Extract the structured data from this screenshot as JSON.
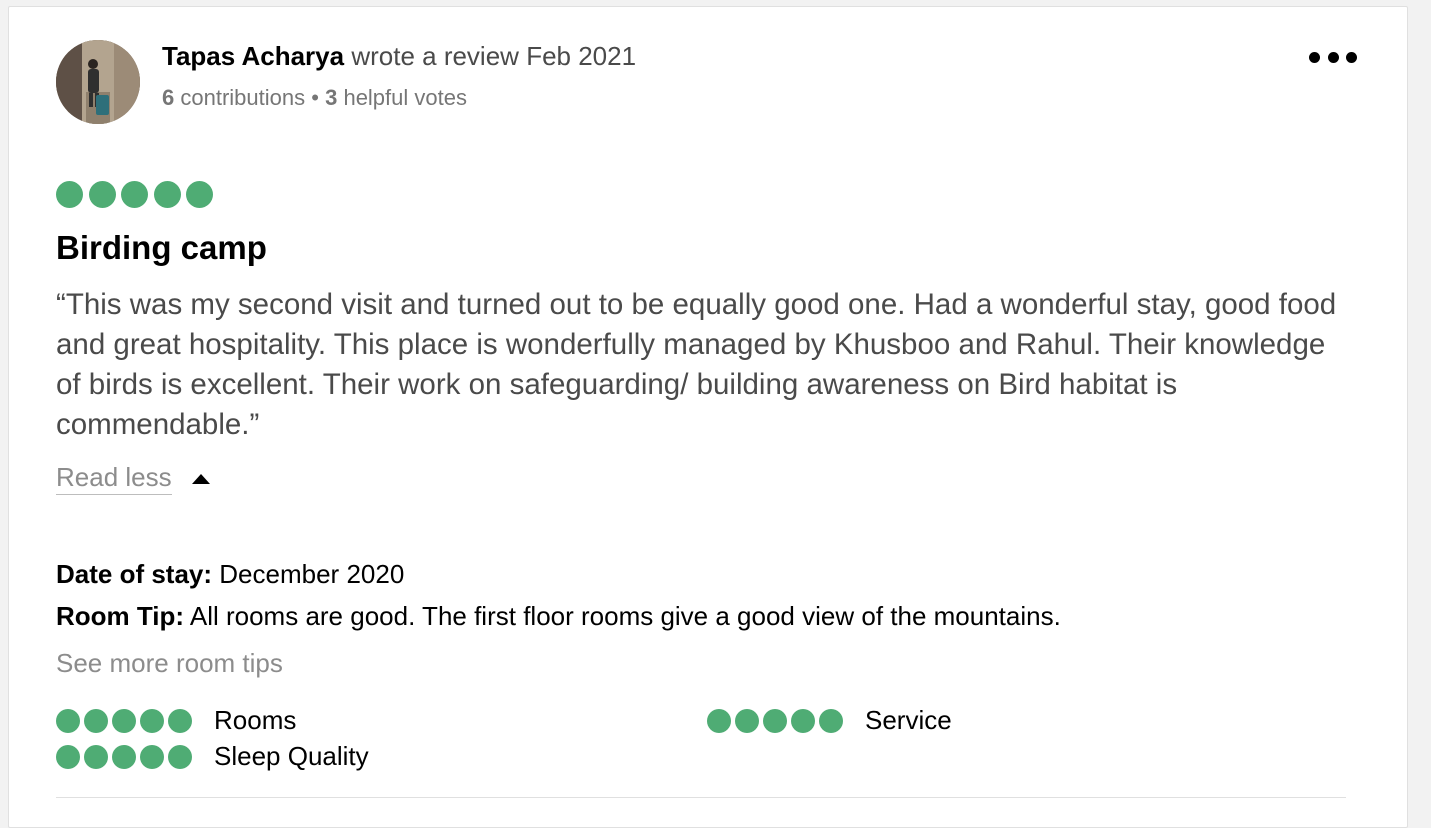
{
  "review": {
    "author": "Tapas Acharya",
    "action": "wrote a review",
    "date": "Feb 2021",
    "contributions_count": "6",
    "contributions_label": "contributions",
    "separator": "•",
    "helpful_count": "3",
    "helpful_label": "helpful votes",
    "rating": 5,
    "title": "Birding camp",
    "body": "“This was my second visit and turned out to be equally good one. Had a wonderful stay, good food and great hospitality. This place is wonderfully managed by Khusboo and Rahul. Their knowledge of birds is excellent. Their work on safeguarding/ building awareness on Bird habitat is commendable.”",
    "read_less": "Read less",
    "date_of_stay_label": "Date of stay:",
    "date_of_stay": "December 2020",
    "room_tip_label": "Room Tip:",
    "room_tip": "All rooms are good. The first floor rooms give a good view of the mountains.",
    "see_more_tips": "See more room tips",
    "sub_ratings": [
      {
        "label": "Rooms",
        "rating": 5
      },
      {
        "label": "Service",
        "rating": 5
      },
      {
        "label": "Sleep Quality",
        "rating": 5
      }
    ]
  },
  "icons": {
    "more": "more-options-icon",
    "caret": "caret-up-icon",
    "rating_bubble": "rating-bubble-icon"
  },
  "colors": {
    "bubble_green": "#4fac74",
    "text_dark": "#000000",
    "text_body": "#4a4a4a",
    "text_muted": "#767676"
  }
}
